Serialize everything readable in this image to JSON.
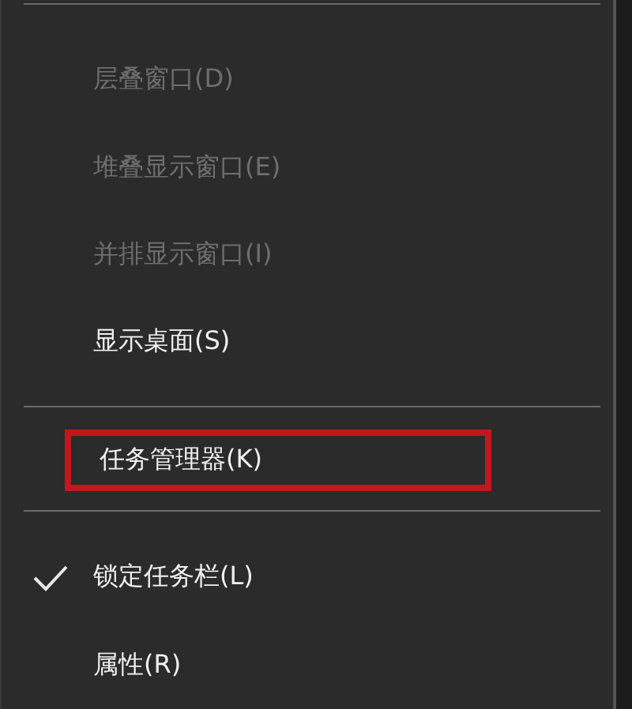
{
  "menu": {
    "items": [
      {
        "kind": "separator"
      },
      {
        "kind": "item",
        "label": "层叠窗口(D)",
        "disabled": true,
        "checked": false,
        "highlighted": false
      },
      {
        "kind": "item",
        "label": "堆叠显示窗口(E)",
        "disabled": true,
        "checked": false,
        "highlighted": false
      },
      {
        "kind": "item",
        "label": "并排显示窗口(I)",
        "disabled": true,
        "checked": false,
        "highlighted": false
      },
      {
        "kind": "item",
        "label": "显示桌面(S)",
        "disabled": false,
        "checked": false,
        "highlighted": false
      },
      {
        "kind": "separator"
      },
      {
        "kind": "item",
        "label": "任务管理器(K)",
        "disabled": false,
        "checked": false,
        "highlighted": true
      },
      {
        "kind": "separator"
      },
      {
        "kind": "item",
        "label": "锁定任务栏(L)",
        "disabled": false,
        "checked": true,
        "highlighted": false
      },
      {
        "kind": "item",
        "label": "属性(R)",
        "disabled": false,
        "checked": false,
        "highlighted": false
      }
    ]
  }
}
